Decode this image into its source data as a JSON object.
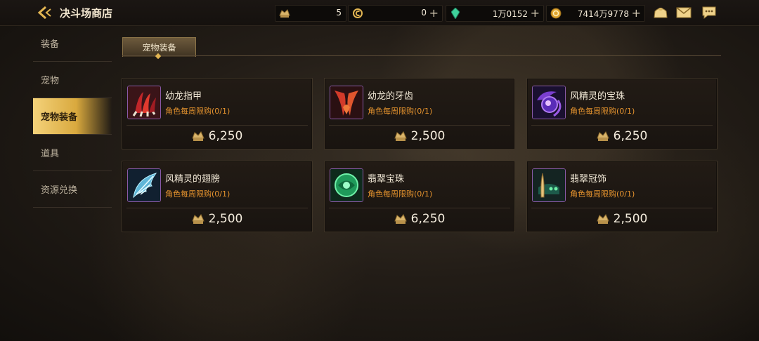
{
  "header": {
    "title": "决斗场商店",
    "resources": [
      {
        "icon": "arena-coin-icon",
        "value": "5",
        "has_plus": false
      },
      {
        "icon": "c-currency-icon",
        "value": "0",
        "has_plus": true
      },
      {
        "icon": "green-crystal-icon",
        "value": "1万0152",
        "has_plus": true
      },
      {
        "icon": "gold-coin-icon",
        "value": "7414万9778",
        "has_plus": true
      }
    ],
    "icons": [
      "shop-bag-icon",
      "mail-icon",
      "chat-icon"
    ]
  },
  "sidebar": {
    "items": [
      {
        "label": "装备",
        "active": false
      },
      {
        "label": "宠物",
        "active": false
      },
      {
        "label": "宠物装备",
        "active": true
      },
      {
        "label": "道具",
        "active": false
      },
      {
        "label": "资源兑换",
        "active": false
      }
    ]
  },
  "tab": {
    "label": "宠物装备"
  },
  "items": [
    {
      "name": "幼龙指甲",
      "limit": "角色每周限购(0/1)",
      "price": "6,250",
      "icon": "dragon-claw-icon"
    },
    {
      "name": "幼龙的牙齿",
      "limit": "角色每周限购(0/1)",
      "price": "2,500",
      "icon": "dragon-fang-icon"
    },
    {
      "name": "风精灵的宝珠",
      "limit": "角色每周限购(0/1)",
      "price": "6,250",
      "icon": "wind-spirit-orb-icon"
    },
    {
      "name": "风精灵的翅膀",
      "limit": "角色每周限购(0/1)",
      "price": "2,500",
      "icon": "wind-spirit-wing-icon"
    },
    {
      "name": "翡翠宝珠",
      "limit": "角色每周限购(0/1)",
      "price": "6,250",
      "icon": "emerald-orb-icon"
    },
    {
      "name": "翡翠冠饰",
      "limit": "角色每周限购(0/1)",
      "price": "2,500",
      "icon": "emerald-crown-icon"
    }
  ],
  "colors": {
    "accent_gold": "#e2b552",
    "limit_orange": "#e5932e",
    "rare_border": "#8a5aa8"
  }
}
